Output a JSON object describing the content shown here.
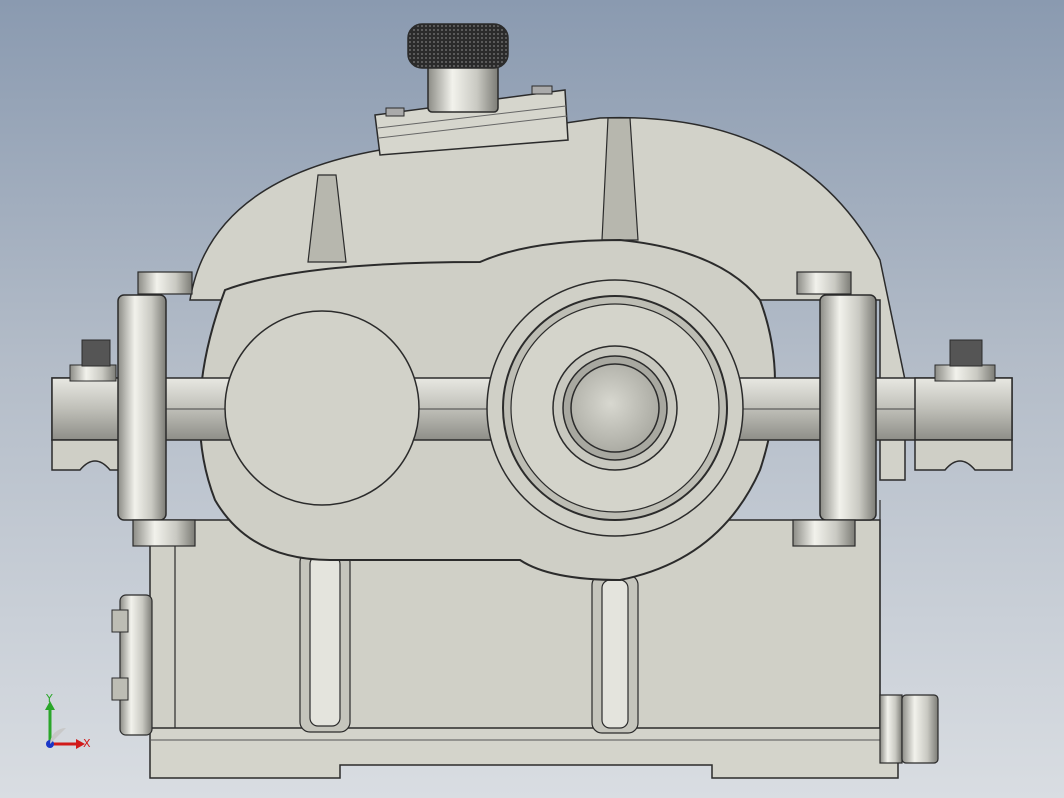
{
  "viewport": {
    "background_top": "#8a9ab0",
    "background_bottom": "#d9dde2",
    "model": "gear-reducer",
    "body_color": "#d2d2c9",
    "edge_color": "#2b2b2b"
  },
  "triad": {
    "x_label": "X",
    "y_label": "Y",
    "x_color": "#d11a1a",
    "y_color": "#2aa62a",
    "z_color": "#1a36c8"
  }
}
